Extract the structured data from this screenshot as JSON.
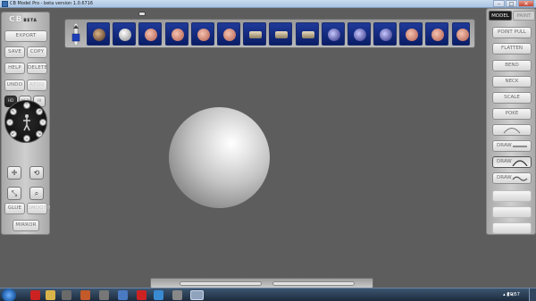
{
  "window": {
    "title": "CB Model Pro - beta version 1.0.6716",
    "controls": [
      "minimize",
      "maximize",
      "close"
    ]
  },
  "left_panel": {
    "logo": "CB",
    "logo_badge": "BETA",
    "export": "EXPORT",
    "save": "SAVE",
    "copy": "COPY",
    "help": "HELP",
    "delete": "DELETE",
    "undo": "UNDO",
    "redo": "REDO",
    "view_modes": [
      "HD",
      "MED",
      "HI"
    ],
    "glue": "GLUE",
    "smooth": "SMOOTH",
    "mirror": "MIRROR"
  },
  "right_panel": {
    "tabs": [
      "MODEL",
      "PAINT"
    ],
    "tools": [
      "POINT PULL",
      "FLATTEN",
      "BEND",
      "NECK",
      "SCALE",
      "POKE"
    ],
    "draw_tools": [
      "DRAW",
      "DRAW",
      "DRAW"
    ],
    "disabled_tools": [
      "",
      "",
      ""
    ]
  },
  "top_strip": {
    "thumbnails": [
      "model-01",
      "model-02",
      "model-03",
      "model-04",
      "model-05",
      "model-06",
      "model-07",
      "model-08",
      "model-09",
      "model-10",
      "model-11",
      "model-12",
      "model-13",
      "model-14",
      "model-15"
    ]
  },
  "taskbar": {
    "clock": "20:57"
  },
  "colors": {
    "viewport_bg": "#5d5d5d",
    "thumb_bg": "#1f3a9a",
    "taskbar_bg": "#2a3d54"
  }
}
